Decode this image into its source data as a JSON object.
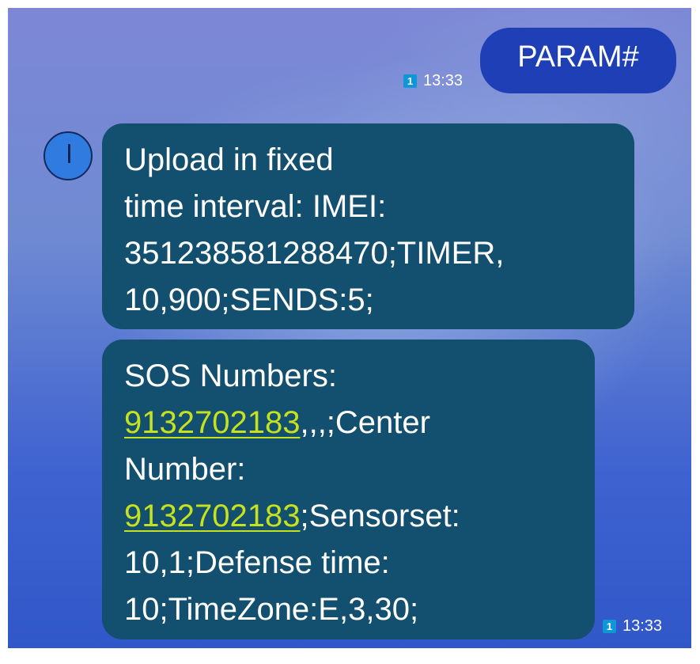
{
  "outgoing": {
    "text": "PARAM#",
    "sim": "1",
    "time": "13:33"
  },
  "incoming": [
    {
      "lines": [
        "Upload in fixed",
        "time interval: IMEI:",
        "351238581288470;TIMER,",
        "10,900;SENDS:5;"
      ]
    },
    {
      "line1": "SOS Numbers:",
      "line2_link": "9132702183",
      "line2_rest": ",,,;Center",
      "line3": "Number:",
      "line4_link": "9132702183",
      "line4_rest": ";Sensorset:",
      "line5": "10,1;Defense time:",
      "line6": "10;TimeZone:E,3,30;",
      "sim": "1",
      "time": "13:33"
    }
  ],
  "colors": {
    "outgoing_bubble": "#1e3fb6",
    "incoming_bubble": "#134f6e",
    "link": "#c6e11e",
    "sim_badge": "#0e97d6",
    "avatar": "#2f7be0"
  },
  "icons": {
    "avatar": "contact-avatar-icon",
    "sim": "sim-1-icon"
  }
}
